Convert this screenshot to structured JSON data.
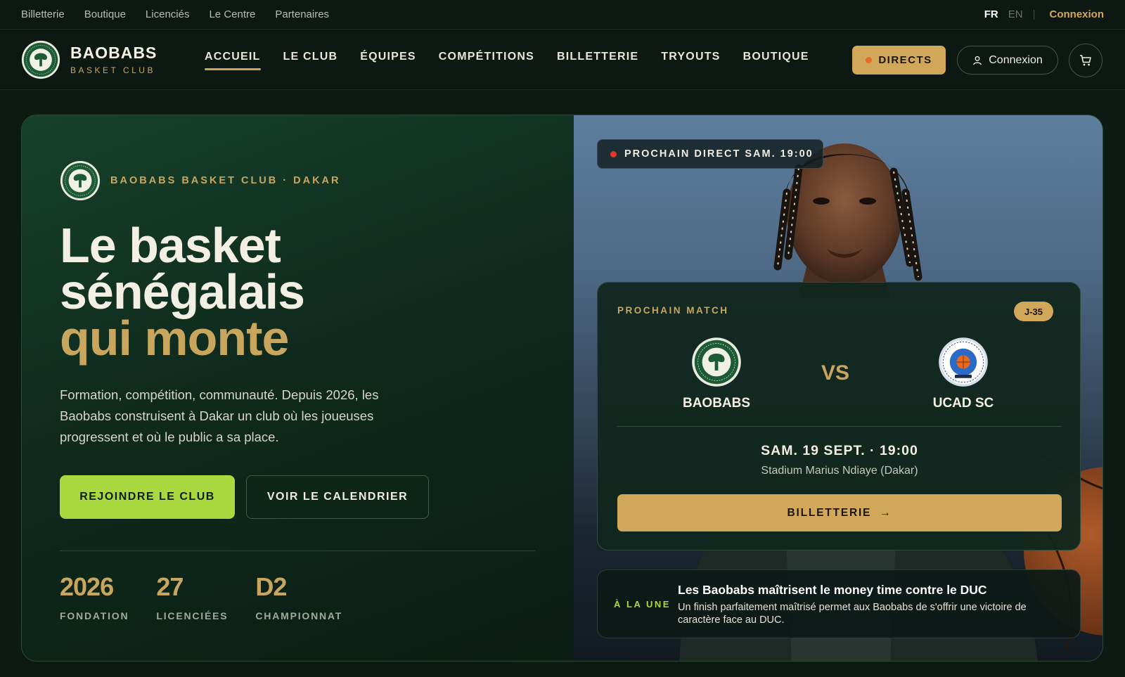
{
  "topbar": {
    "links": [
      "Billetterie",
      "Boutique",
      "Licenciés",
      "Le Centre",
      "Partenaires"
    ],
    "lang_fr": "FR",
    "lang_en": "EN",
    "separator": "|",
    "login": "Connexion"
  },
  "header": {
    "brand_name": "BAOBABS",
    "brand_sub": "BASKET CLUB",
    "logo_text": "BAOBABS · BASKET CLUB",
    "nav": [
      "ACCUEIL",
      "LE CLUB",
      "ÉQUIPES",
      "COMPÉTITIONS",
      "BILLETTERIE",
      "TRYOUTS",
      "BOUTIQUE"
    ],
    "active_nav": "ACCUEIL",
    "directs_label": "DIRECTS",
    "login_label": "Connexion",
    "icons": {
      "user": "user-icon",
      "cart": "cart-icon"
    }
  },
  "hero": {
    "eyebrow": "BAOBABS BASKET CLUB · DAKAR",
    "headline_line1": "Le basket",
    "headline_line2": "sénégalais",
    "headline_line3": "qui monte",
    "lead": "Formation, compétition, communauté. Depuis 2026, les Baobabs construisent à Dakar un club où les joueuses progressent et où le public a sa place.",
    "cta_primary": "REJOINDRE LE CLUB",
    "cta_secondary": "VOIR LE CALENDRIER",
    "stats": [
      {
        "value": "2026",
        "label": "FONDATION"
      },
      {
        "value": "27",
        "label": "LICENCIÉES"
      },
      {
        "value": "D2",
        "label": "CHAMPIONNAT"
      }
    ]
  },
  "live": {
    "label": "PROCHAIN DIRECT SAM. 19:00"
  },
  "match": {
    "eyebrow": "PROCHAIN MATCH",
    "countdown": "J-35",
    "home": "BAOBABS",
    "away": "UCAD SC",
    "vs": "VS",
    "date": "SAM. 19 SEPT. · 19:00",
    "venue": "Stadium Marius Ndiaye (Dakar)",
    "ticket_label": "BILLETTERIE",
    "ticket_arrow": "→"
  },
  "news": {
    "tag": "À LA UNE",
    "title": "Les Baobabs maîtrisent le money time contre le DUC",
    "body": "Un finish parfaitement maîtrisé permet aux Baobabs de s'offrir une victoire de caractère face au DUC."
  },
  "colors": {
    "background": "#0c1a13",
    "gold": "#c9a65e",
    "gold_button": "#d1a85a",
    "lime": "#a8d93e",
    "live_red": "#e0372c",
    "live_orange": "#e9692a"
  }
}
